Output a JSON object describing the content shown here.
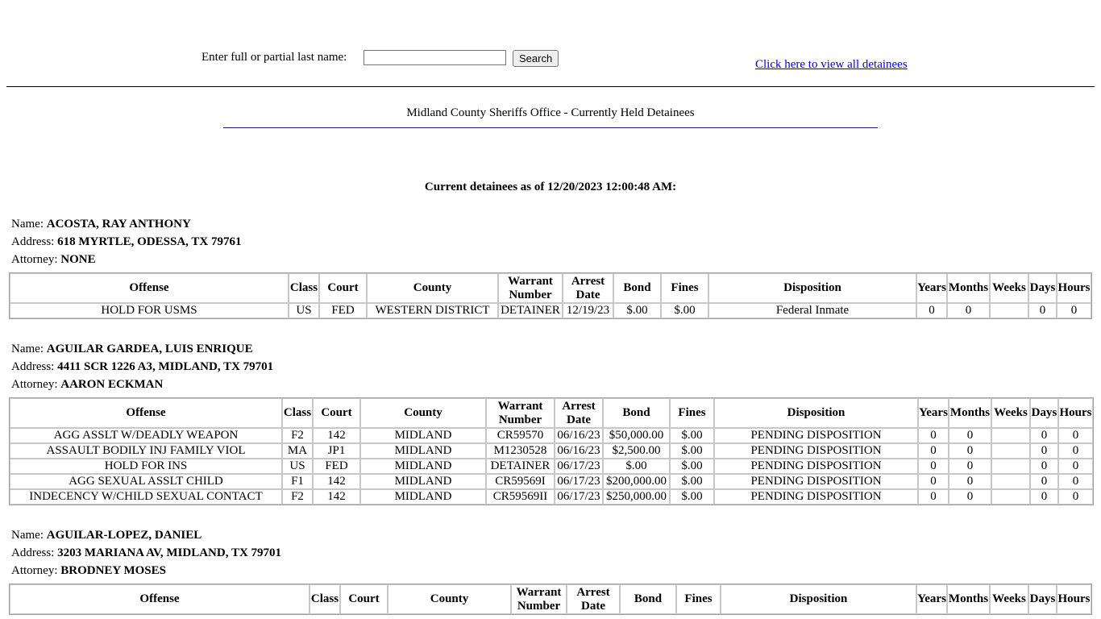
{
  "search": {
    "label": "Enter full or partial last name:",
    "input_value": "",
    "button": "Search",
    "view_all": "Click here to view all detainees"
  },
  "page_title": "Midland County Sheriffs Office - Currently Held Detainees",
  "as_of": "Current detainees as of 12/20/2023 12:00:48 AM:",
  "labels": {
    "name": "Name: ",
    "address": "Address: ",
    "attorney": "Attorney: "
  },
  "columns": [
    "Offense",
    "Class",
    "Court",
    "County",
    "Warrant Number",
    "Arrest Date",
    "Bond",
    "Fines",
    "Disposition",
    "Years",
    "Months",
    "Weeks",
    "Days",
    "Hours"
  ],
  "detainees": [
    {
      "name": "ACOSTA, RAY ANTHONY",
      "address": "618 MYRTLE, ODESSA, TX 79761",
      "attorney": "NONE",
      "charges": [
        [
          "HOLD FOR USMS",
          "US",
          "FED",
          "WESTERN DISTRICT",
          "DETAINER",
          "12/19/23",
          "$.00",
          "$.00",
          "Federal Inmate",
          "0",
          "0",
          "",
          "0",
          "0"
        ]
      ]
    },
    {
      "name": "AGUILAR GARDEA, LUIS ENRIQUE",
      "address": "4411 SCR 1226 A3, MIDLAND, TX 79701",
      "attorney": "AARON ECKMAN",
      "charges": [
        [
          "AGG ASSLT W/DEADLY WEAPON",
          "F2",
          "142",
          "MIDLAND",
          "CR59570",
          "06/16/23",
          "$50,000.00",
          "$.00",
          "PENDING DISPOSITION",
          "0",
          "0",
          "",
          "0",
          "0"
        ],
        [
          "ASSAULT BODILY INJ FAMILY VIOL",
          "MA",
          "JP1",
          "MIDLAND",
          "M1230528",
          "06/16/23",
          "$2,500.00",
          "$.00",
          "PENDING DISPOSITION",
          "0",
          "0",
          "",
          "0",
          "0"
        ],
        [
          "HOLD FOR INS",
          "US",
          "FED",
          "MIDLAND",
          "DETAINER",
          "06/17/23",
          "$.00",
          "$.00",
          "PENDING DISPOSITION",
          "0",
          "0",
          "",
          "0",
          "0"
        ],
        [
          "AGG SEXUAL ASSLT CHILD",
          "F1",
          "142",
          "MIDLAND",
          "CR59569I",
          "06/17/23",
          "$200,000.00",
          "$.00",
          "PENDING DISPOSITION",
          "0",
          "0",
          "",
          "0",
          "0"
        ],
        [
          "INDECENCY W/CHILD SEXUAL CONTACT",
          "F2",
          "142",
          "MIDLAND",
          "CR59569II",
          "06/17/23",
          "$250,000.00",
          "$.00",
          "PENDING DISPOSITION",
          "0",
          "0",
          "",
          "0",
          "0"
        ]
      ]
    },
    {
      "name": "AGUILAR-LOPEZ, DANIEL",
      "address": "3203 MARIANA AV, MIDLAND, TX 79701",
      "attorney": "BRODNEY MOSES",
      "charges": []
    }
  ]
}
